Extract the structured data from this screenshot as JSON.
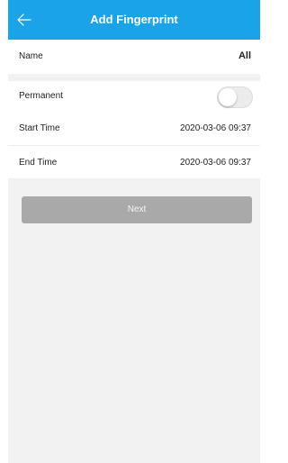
{
  "header": {
    "title": "Add Fingerprint",
    "back_icon": "arrow-left-icon",
    "color": "#1aa3e8"
  },
  "form": {
    "name": {
      "label": "Name",
      "value": "All"
    },
    "permanent": {
      "label": "Permanent",
      "enabled": false
    },
    "start_time": {
      "label": "Start Time",
      "value": "2020-03-06 09:37"
    },
    "end_time": {
      "label": "End Time",
      "value": "2020-03-06 09:37"
    }
  },
  "next_button": {
    "label": "Next",
    "enabled": false
  }
}
